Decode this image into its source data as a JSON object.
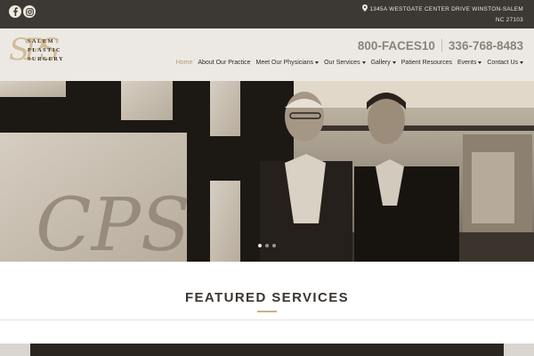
{
  "topbar": {
    "social": [
      {
        "name": "facebook-icon"
      },
      {
        "name": "instagram-icon"
      }
    ],
    "address": "1345A WESTGATE CENTER DRIVE WINSTON-SALEM NC 27103"
  },
  "logo": {
    "monogram": "SPS",
    "line1": "SALEM",
    "line2": "PLASTIC",
    "line3": "SURGERY"
  },
  "phones": {
    "vanity": "800-FACES10",
    "local": "336-768-8483"
  },
  "nav": {
    "items": [
      {
        "label": "Home",
        "active": true,
        "dropdown": false
      },
      {
        "label": "About Our Practice",
        "active": false,
        "dropdown": false
      },
      {
        "label": "Meet Our Physicians",
        "active": false,
        "dropdown": true
      },
      {
        "label": "Our Services",
        "active": false,
        "dropdown": true
      },
      {
        "label": "Gallery",
        "active": false,
        "dropdown": true
      },
      {
        "label": "Patient Resources",
        "active": false,
        "dropdown": false
      },
      {
        "label": "Events",
        "active": false,
        "dropdown": true
      },
      {
        "label": "Contact Us",
        "active": false,
        "dropdown": true
      }
    ]
  },
  "hero": {
    "window_monogram": "CPS",
    "slides_total": 3,
    "slide_active": 1
  },
  "featured": {
    "heading": "FEATURED SERVICES"
  },
  "colors": {
    "topbar": "#3c3833",
    "header": "#ece9e4",
    "accent_gold": "#b59a68",
    "text_dark": "#2f2a25",
    "phone_gray": "#8a8379"
  }
}
